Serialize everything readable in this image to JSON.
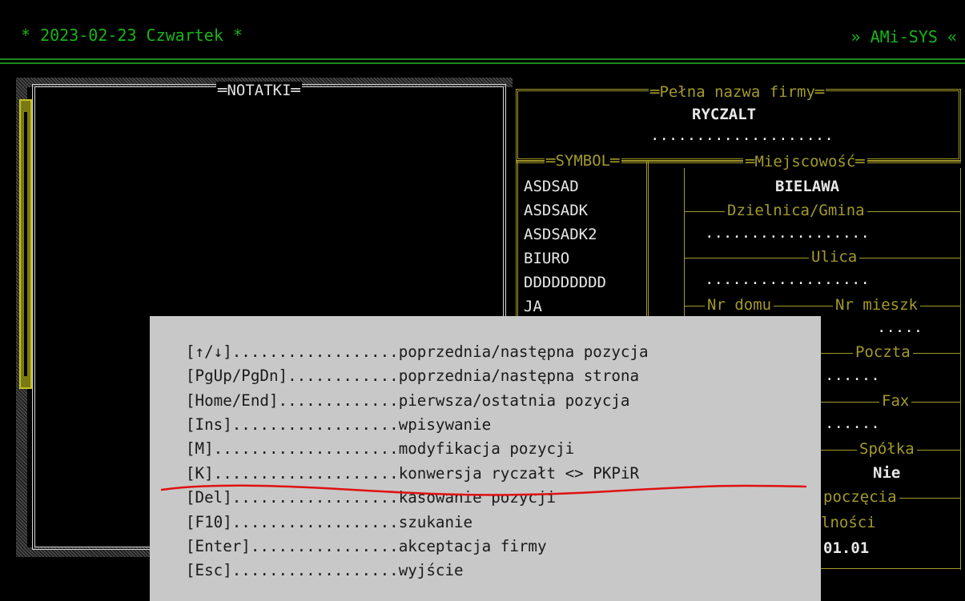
{
  "header": {
    "date_line": "* 2023-02-23 Czwartek *",
    "app_name": "» AMi-SYS «"
  },
  "notes_panel": {
    "title": "═NOTATKI═"
  },
  "firm_panel": {
    "title": "═Pełna nazwa firmy═",
    "name": "RYCZALT",
    "dots": "...................."
  },
  "symbol_panel": {
    "title": "═SYMBOL═",
    "items": [
      "ASDSAD",
      "ASDSADK",
      "ASDSADK2",
      "BIURO",
      "DDDDDDDDD",
      "JA"
    ]
  },
  "details_panel": {
    "miejscowosc_label": "═Miejscowość═",
    "miejscowosc_value": "BIELAWA",
    "dzielnica_label": "Dzielnica/Gmina",
    "dzielnica_value": "..................",
    "ulica_label": "Ulica",
    "ulica_value": "..................",
    "nr_domu_label": "Nr domu",
    "nr_mieszk_label": "Nr mieszk",
    "nr_mieszk_value": ".....",
    "poczta_label": "Poczta",
    "poczta_value": "......",
    "fax_label": "Fax",
    "fax_value": "......",
    "spolka_label": "Spółka",
    "spolka_value": "Nie",
    "rozpoczecia_label": "poczęcia",
    "dzialalnosci_label": "lności",
    "date_value": "01.01"
  },
  "help_popup": {
    "lines": [
      "[↑/↓]..................poprzednia/następna pozycja",
      "[PgUp/PgDn]............poprzednia/następna strona",
      "[Home/End].............pierwsza/ostatnia pozycja",
      "[Ins]..................wpisywanie",
      "[M]....................modyfikacja pozycji",
      "[K]....................konwersja ryczałt <> PKPiR",
      "[Del]..................kasowanie pozycji",
      "[F10]..................szukanie",
      "[Enter]................akceptacja firmy",
      "[Esc]..................wyjście"
    ]
  },
  "colors": {
    "background": "#000000",
    "green_text": "#18b418",
    "olive_frame": "#a39a2a",
    "popup_bg": "#c8c8c8",
    "annotation_red": "#e01010"
  }
}
